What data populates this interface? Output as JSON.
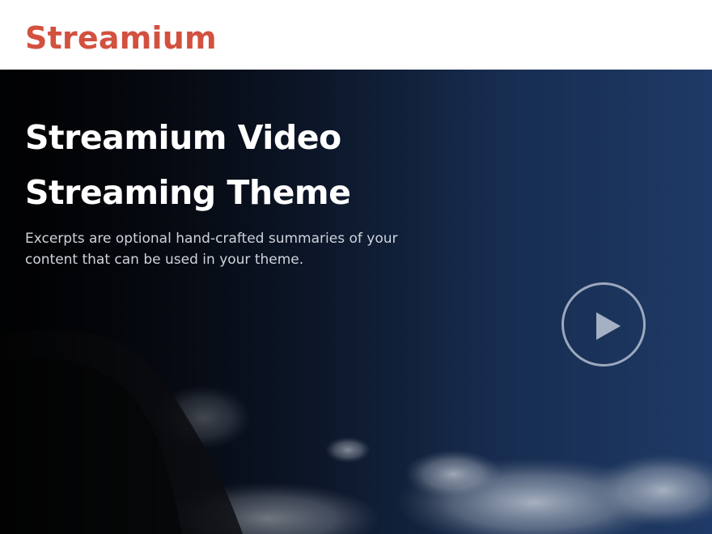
{
  "header": {
    "logo_text": "Streamium"
  },
  "hero": {
    "title": "Streamium Video Streaming Theme",
    "excerpt": "Excerpts are optional hand-crafted summaries of your content that can be used in your theme.",
    "play_icon": "play-icon"
  },
  "colors": {
    "brand": "#d2513f",
    "hero_dark": "#06090f",
    "hero_blue": "#1e3a66",
    "text_light": "#ffffff",
    "excerpt_text": "#cfd4dc"
  }
}
